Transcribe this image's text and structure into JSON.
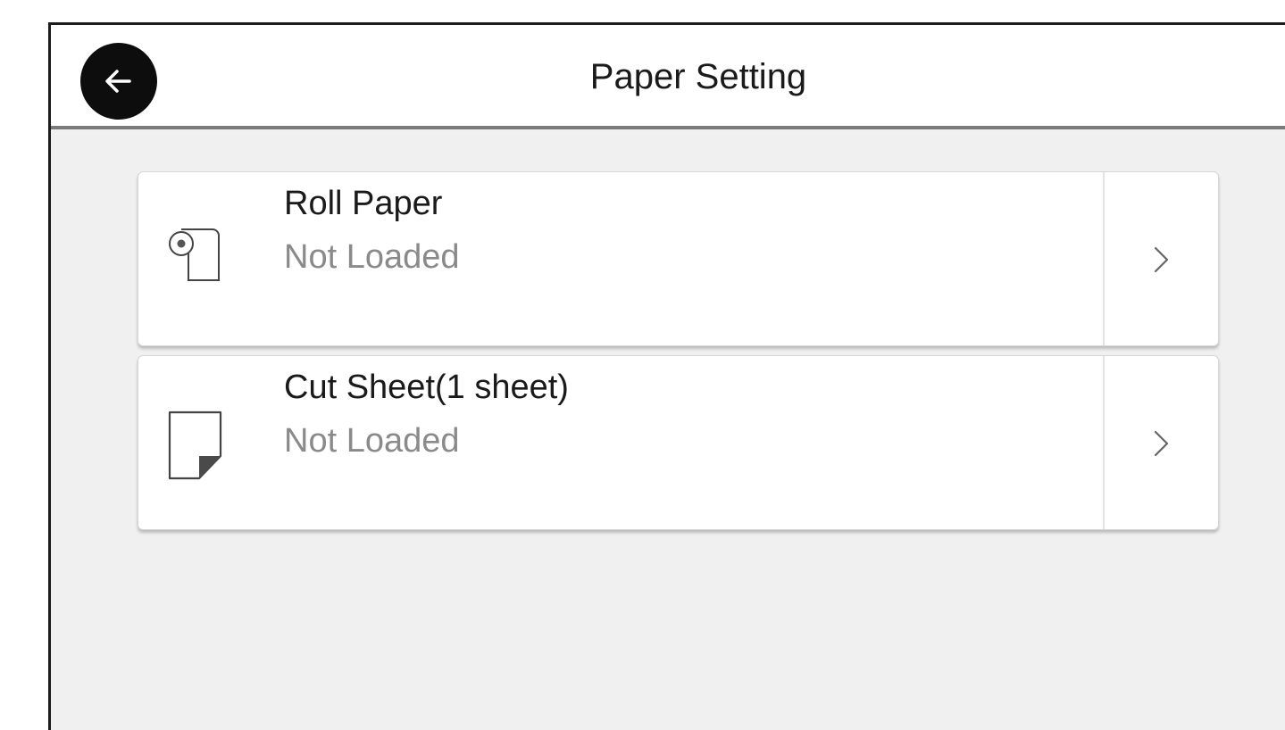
{
  "header": {
    "title": "Paper Setting",
    "back_icon": "arrow-left-icon"
  },
  "paper_sources": [
    {
      "icon": "roll-paper-icon",
      "title": "Roll Paper",
      "status": "Not Loaded"
    },
    {
      "icon": "cut-sheet-icon",
      "title": "Cut Sheet(1 sheet)",
      "status": "Not Loaded"
    }
  ]
}
